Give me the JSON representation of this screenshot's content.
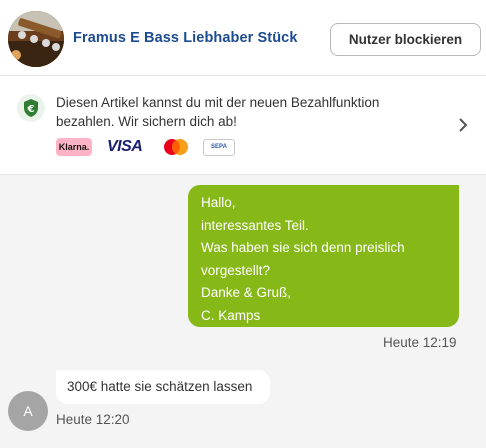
{
  "header": {
    "listing_title": "Framus E Bass Liebhaber Stück",
    "block_button_label": "Nutzer blockieren",
    "thumbnail_icon": "bass-guitar-photo"
  },
  "payment_banner": {
    "text": "Diesen Artikel kannst du mit der neuen Bezahlfunktion bezahlen. Wir sichern dich ab!",
    "icon": "euro-shield-icon",
    "logos": {
      "klarna": "Klarna.",
      "visa": "VISA",
      "mastercard": "mastercard",
      "sepa": "SEPA"
    }
  },
  "messages": [
    {
      "direction": "outgoing",
      "lines": [
        "Hallo,",
        "interessantes Teil.",
        "Was haben sie sich denn preislich",
        "vorgestellt?",
        "Danke & Gruß,",
        "C. Kamps"
      ],
      "time": "Heute 12:19"
    },
    {
      "direction": "incoming",
      "avatar_letter": "A",
      "text": "300€ hatte sie schätzen lassen",
      "time": "Heute 12:20"
    }
  ],
  "colors": {
    "accent_green": "#86b817",
    "link_blue": "#1d4b8f",
    "chat_background": "#f4f4f4",
    "shield_green": "#2e7d32"
  }
}
